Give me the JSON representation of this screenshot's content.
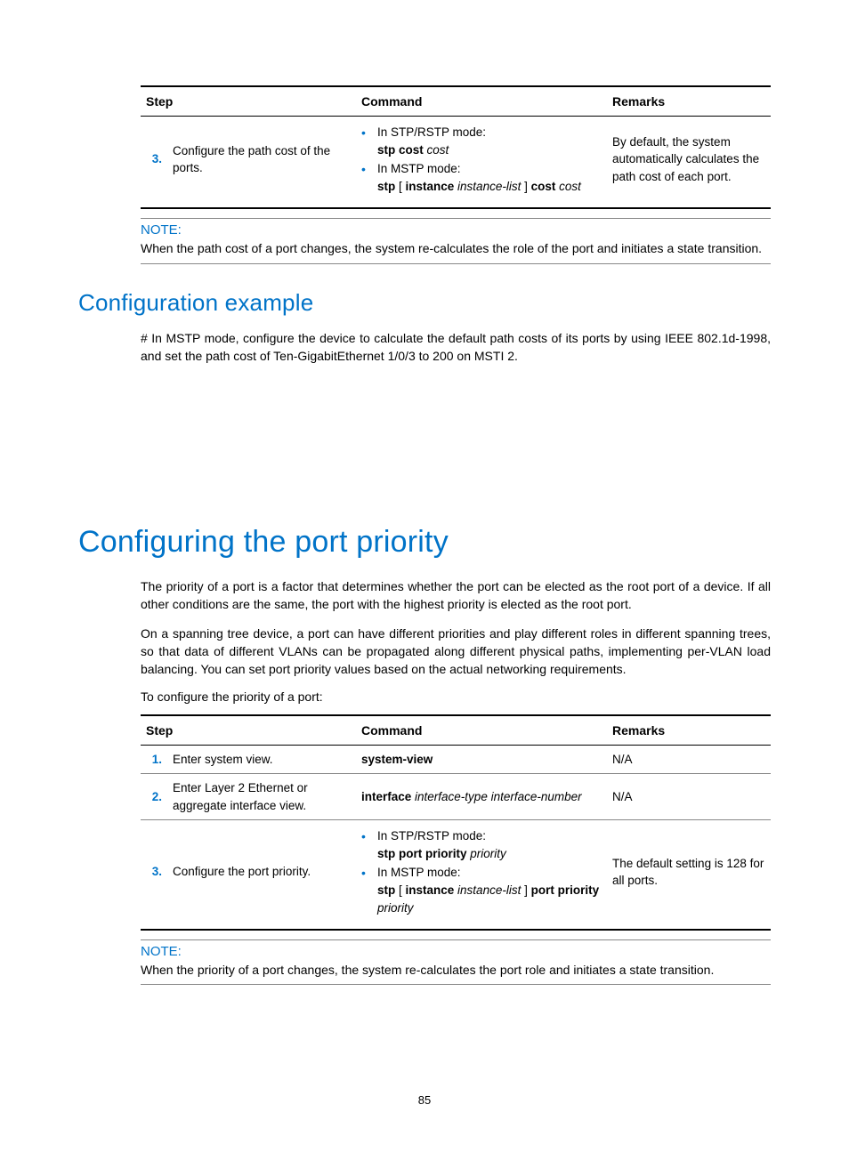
{
  "page_number": "85",
  "table1": {
    "headers": [
      "Step",
      "Command",
      "Remarks"
    ],
    "row": {
      "num": "3.",
      "step": "Configure the path cost of the ports.",
      "cmd_mode1_label": "In STP/RSTP mode:",
      "cmd_mode1_bold": "stp cost",
      "cmd_mode1_ital": " cost",
      "cmd_mode2_label": "In MSTP mode:",
      "cmd_mode2_bold_a": "stp",
      "cmd_mode2_plain_a": " [ ",
      "cmd_mode2_bold_b": "instance",
      "cmd_mode2_ital_a": " instance-list",
      "cmd_mode2_plain_b": " ] ",
      "cmd_mode2_bold_c": "cost",
      "cmd_mode2_ital_b": " cost",
      "remarks": "By default, the system automatically calculates the path cost of each port."
    }
  },
  "note1": {
    "label": "NOTE:",
    "text": "When the path cost of a port changes, the system re-calculates the role of the port and initiates a state transition."
  },
  "config_example": {
    "title": "Configuration example",
    "text": "# In MSTP mode, configure the device to calculate the default path costs of its ports by using IEEE 802.1d-1998, and set the path cost of Ten-GigabitEthernet 1/0/3 to 200 on MSTI 2."
  },
  "port_priority": {
    "title": "Configuring the port priority",
    "p1": "The priority of a port is a factor that determines whether the port can be elected as the root port of a device. If all other conditions are the same, the port with the highest priority is elected as the root port.",
    "p2": "On a spanning tree device, a port can have different priorities and play different roles in different spanning trees, so that data of different VLANs can be propagated along different physical paths, implementing per-VLAN load balancing. You can set port priority values based on the actual networking requirements.",
    "lead": "To configure the priority of a port:"
  },
  "table2": {
    "headers": [
      "Step",
      "Command",
      "Remarks"
    ],
    "rows": [
      {
        "num": "1.",
        "step": "Enter system view.",
        "cmd_bold": "system-view",
        "remarks": "N/A"
      },
      {
        "num": "2.",
        "step": "Enter Layer 2 Ethernet or aggregate interface view.",
        "cmd_bold": "interface",
        "cmd_ital": " interface-type interface-number",
        "remarks": "N/A"
      },
      {
        "num": "3.",
        "step": "Configure the port priority.",
        "cmd_mode1_label": "In STP/RSTP mode:",
        "cmd_mode1_bold": "stp port priority",
        "cmd_mode1_ital": " priority",
        "cmd_mode2_label": "In MSTP mode:",
        "cmd_mode2_bold_a": "stp",
        "cmd_mode2_plain_a": " [ ",
        "cmd_mode2_bold_b": "instance",
        "cmd_mode2_ital_a": " instance-list",
        "cmd_mode2_plain_b": " ] ",
        "cmd_mode2_bold_c": "port priority",
        "cmd_mode2_ital_b": " priority",
        "remarks": "The default setting is 128 for all ports."
      }
    ]
  },
  "note2": {
    "label": "NOTE:",
    "text": "When the priority of a port changes, the system re-calculates the port role and initiates a state transition."
  }
}
